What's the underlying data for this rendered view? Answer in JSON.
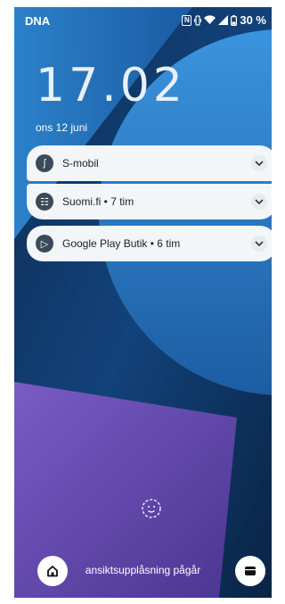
{
  "status_bar": {
    "carrier": "DNA",
    "nfc_icon": "N",
    "battery": "30 %"
  },
  "lock_screen": {
    "time": "17.02",
    "date": "ons 12 juni"
  },
  "notifications": [
    {
      "icon": "s-mobil-icon",
      "icon_glyph": "ʃ",
      "text": "S-mobil"
    },
    {
      "icon": "suomi-fi-icon",
      "icon_glyph": "☷",
      "text": "Suomi.fi • 7 tim"
    },
    {
      "icon": "google-play-icon",
      "icon_glyph": "▷",
      "text": "Google Play Butik • 6 tim"
    }
  ],
  "bottom": {
    "unlock_status": "ansiktsupplåsning pågår"
  },
  "colors": {
    "background": "#1b5fa8",
    "notification_bg": "#f3f6f8",
    "accent_purple": "#6a4fb3"
  }
}
